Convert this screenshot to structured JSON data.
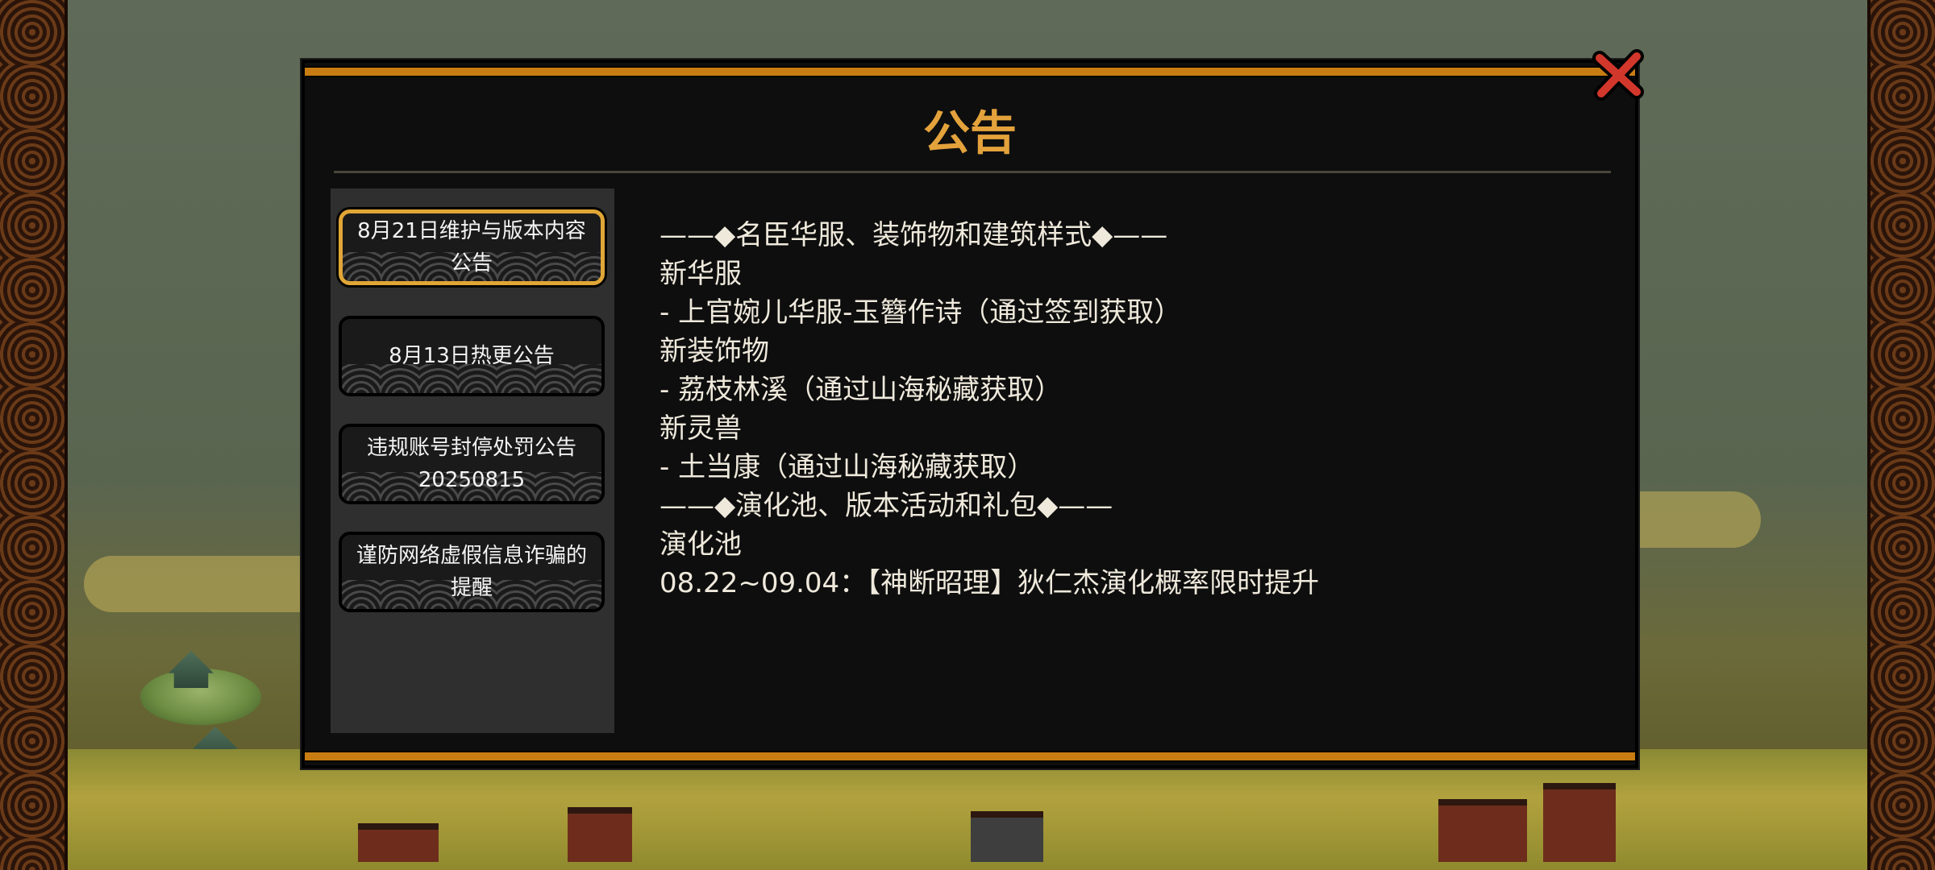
{
  "dialog": {
    "title": "公告",
    "close_label": "×"
  },
  "sidebar": {
    "items": [
      {
        "label": "8月21日维护与版本内容公告",
        "active": true
      },
      {
        "label": "8月13日热更公告",
        "active": false
      },
      {
        "label": "违规账号封停处罚公告20250815",
        "active": false
      },
      {
        "label": "谨防网络虚假信息诈骗的提醒",
        "active": false
      }
    ]
  },
  "content": {
    "lines": [
      "——◆名臣华服、装饰物和建筑样式◆——",
      "新华服",
      "- 上官婉儿华服-玉簪作诗（通过签到获取）",
      "",
      "新装饰物",
      "- 荔枝林溪（通过山海秘藏获取）",
      "",
      "新灵兽",
      "- 土当康（通过山海秘藏获取）",
      "",
      "——◆演化池、版本活动和礼包◆——",
      "演化池",
      "08.22~09.04：【神断昭理】狄仁杰演化概率限时提升"
    ]
  },
  "colors": {
    "accent_gold": "#e3a23b",
    "bar_orange": "#c87d12",
    "close_red": "#d2372b"
  }
}
